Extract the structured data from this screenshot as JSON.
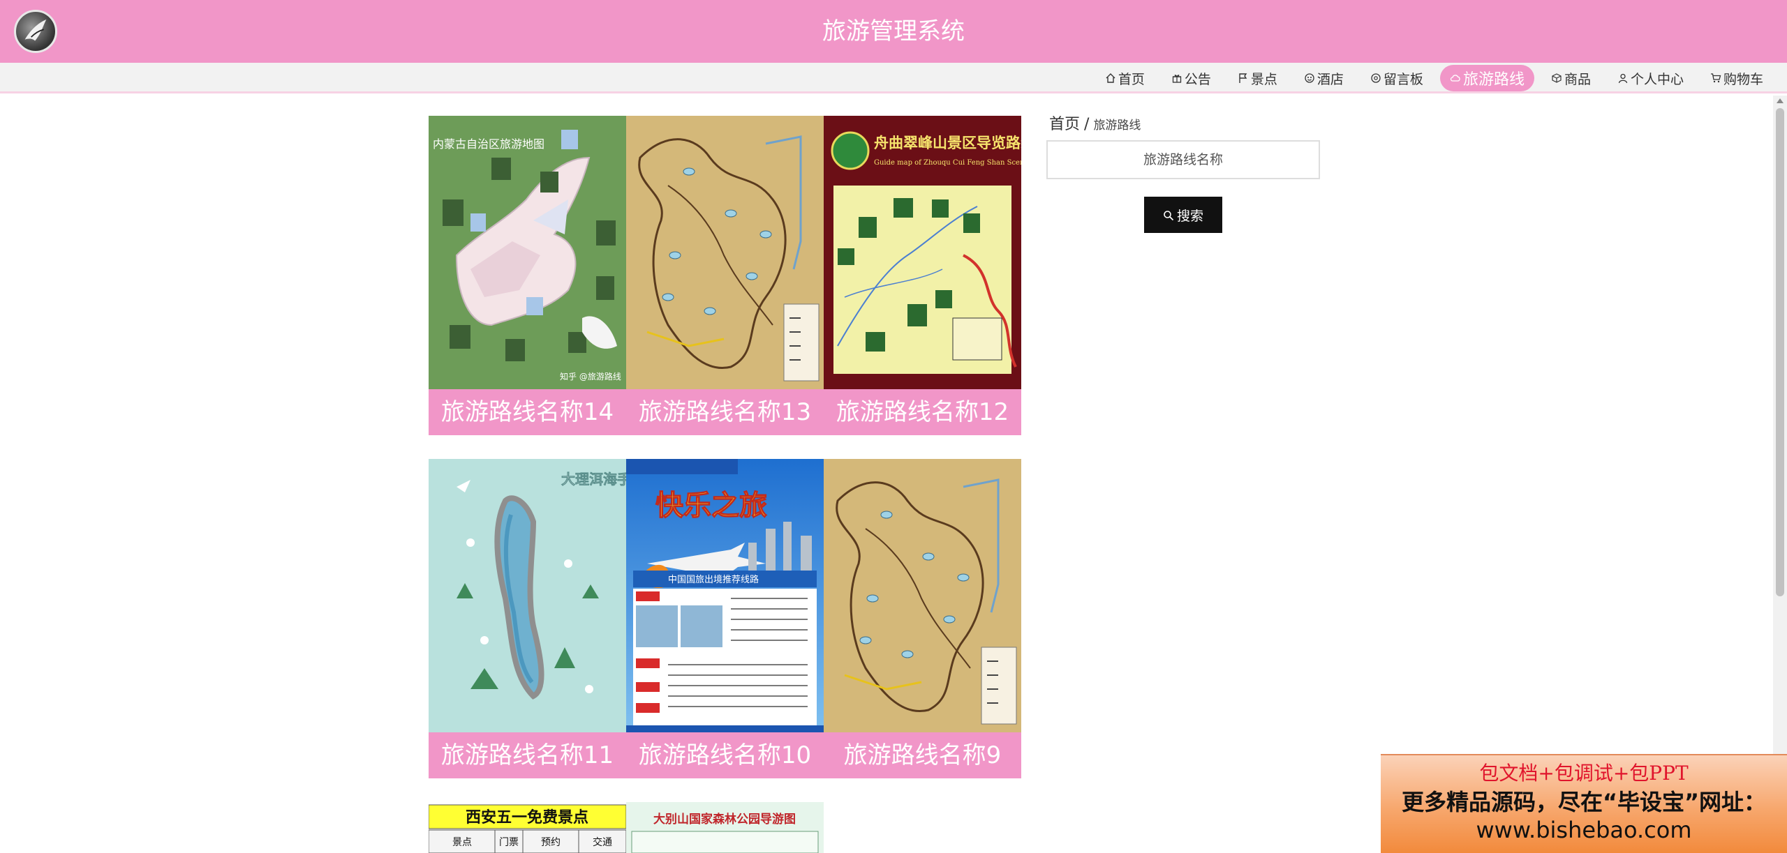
{
  "header": {
    "title": "旅游管理系统"
  },
  "nav": [
    {
      "label": "首页",
      "icon": "home-icon",
      "active": false
    },
    {
      "label": "公告",
      "icon": "gift-icon",
      "active": false
    },
    {
      "label": "景点",
      "icon": "flag-icon",
      "active": false
    },
    {
      "label": "酒店",
      "icon": "hotel-icon",
      "active": false
    },
    {
      "label": "留言板",
      "icon": "message-icon",
      "active": false
    },
    {
      "label": "旅游路线",
      "icon": "cloud-icon",
      "active": true
    },
    {
      "label": "商品",
      "icon": "box-icon",
      "active": false
    },
    {
      "label": "个人中心",
      "icon": "user-icon",
      "active": false
    },
    {
      "label": "购物车",
      "icon": "cart-icon",
      "active": false
    }
  ],
  "colors": {
    "brand_pink": "#f196c8",
    "nav_bg": "#f2f2f2",
    "button_dark": "#111111"
  },
  "routes": [
    {
      "name": "旅游路线名称14",
      "thumb": "green-region-map"
    },
    {
      "name": "旅游路线名称13",
      "thumb": "tan-route-map"
    },
    {
      "name": "旅游路线名称12",
      "thumb": "scenic-area-guide-map"
    },
    {
      "name": "旅游路线名称11",
      "thumb": "lake-hand-drawn-map"
    },
    {
      "name": "旅游路线名称10",
      "thumb": "travel-poster"
    },
    {
      "name": "旅游路线名称9",
      "thumb": "tan-route-map"
    }
  ],
  "thumb_text": {
    "r14_heading": "内蒙古自治区旅游地图",
    "r14_credit": "知乎 @旅游路线",
    "r12_heading": "舟曲翠峰山景区导览路线图",
    "r12_sub": "Guide map of Zhouqu Cui Feng Shan Scenic Area",
    "r11_heading": "大理洱海手绘地图",
    "r10_heading": "快乐之旅",
    "r10_banner": "中国国旅出境推荐线路"
  },
  "partial_cards": [
    {
      "title": "西安五一免费景点",
      "cols": [
        "景点",
        "门票",
        "预约",
        "交通"
      ]
    },
    {
      "title": "大别山国家森林公园导游图"
    }
  ],
  "breadcrumb": {
    "home": "首页",
    "separator": "/",
    "current": "旅游路线"
  },
  "search": {
    "placeholder": "旅游路线名称",
    "button_label": "搜索"
  },
  "ad": {
    "line1": "包文档+包调试+包PPT",
    "line2": "更多精品源码，尽在“毕设宝”网址：",
    "line3": "www.bishebao.com"
  }
}
